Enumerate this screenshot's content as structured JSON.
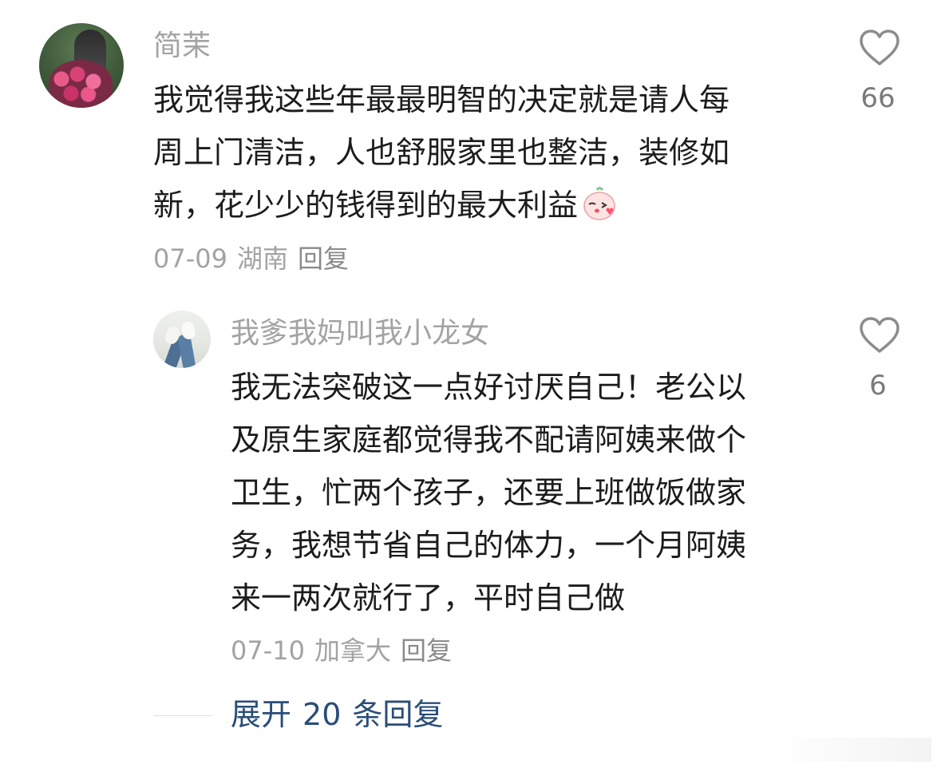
{
  "comment": {
    "username": "简茉",
    "text_lines": [
      "我觉得我这些年最最明智的决定就是请人每",
      "周上门清洁，人也舒服家里也整洁，装修如",
      "新，花少少的钱得到的最大利益"
    ],
    "emoji": "kiss-emoji",
    "date": "07-09",
    "location": "湖南",
    "reply_label": "回复",
    "like_count": "66"
  },
  "reply": {
    "username": "我爹我妈叫我小龙女",
    "text_lines": [
      "我无法突破这一点好讨厌自己！老公以",
      "及原生家庭都觉得我不配请阿姨来做个",
      "卫生，忙两个孩子，还要上班做饭做家",
      "务，我想节省自己的体力，一个月阿姨",
      "来一两次就行了，平时自己做"
    ],
    "date": "07-10",
    "location": "加拿大",
    "reply_label": "回复",
    "like_count": "6"
  },
  "expand": {
    "prefix": "展开",
    "count": "20",
    "suffix": "条回复"
  },
  "colors": {
    "username": "#a3a3a3",
    "text": "#1c1c1c",
    "meta": "#a3a3a3",
    "link": "#2a4d78",
    "icon": "#8c8c8c"
  }
}
